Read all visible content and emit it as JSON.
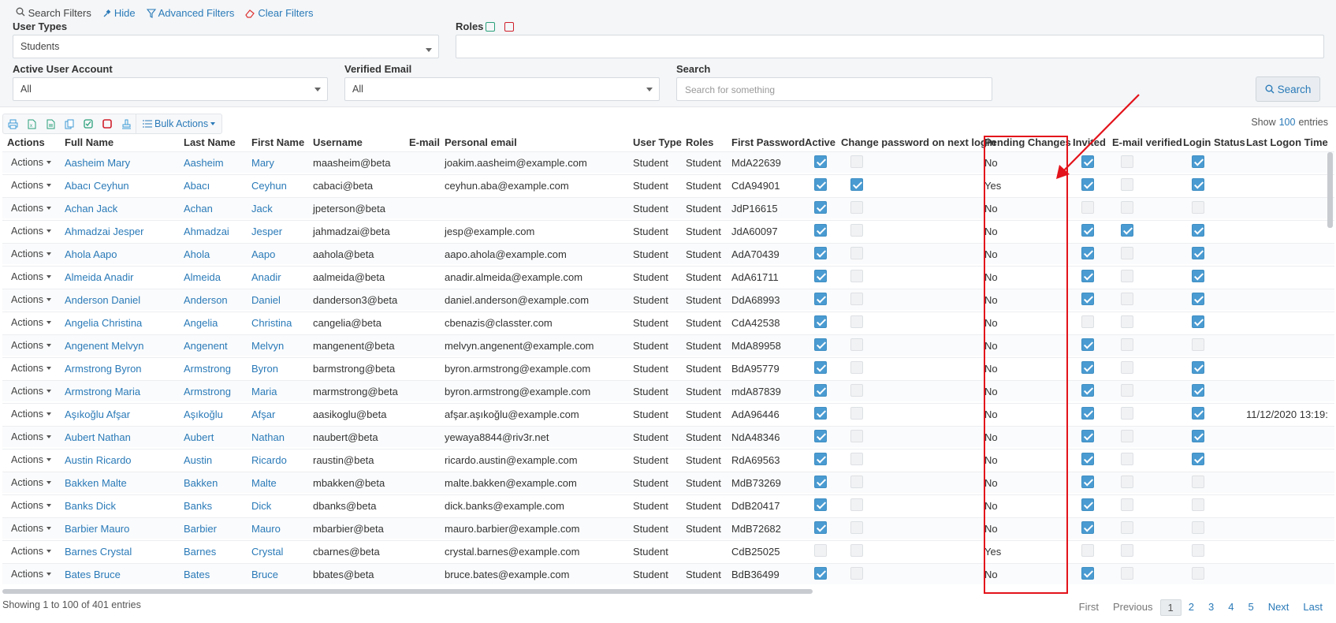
{
  "filters": {
    "search_filters": "Search Filters",
    "hide": "Hide",
    "advanced": "Advanced Filters",
    "clear": "Clear Filters",
    "user_types_label": "User Types",
    "user_types_value": "Students",
    "roles_label": "Roles",
    "active_label": "Active User Account",
    "active_value": "All",
    "verified_label": "Verified Email",
    "verified_value": "All",
    "search_label": "Search",
    "search_placeholder": "Search for something",
    "search_button": "Search"
  },
  "toolbar": {
    "bulk_actions": "Bulk Actions"
  },
  "show": {
    "prefix": "Show",
    "value": "100",
    "suffix": "entries"
  },
  "columns": [
    "Actions",
    "Full Name",
    "Last Name",
    "First Name",
    "Username",
    "E-mail",
    "Personal email",
    "User Type",
    "Roles",
    "First Password",
    "Active",
    "Change password on next login",
    "Pending Changes",
    "Invited",
    "E-mail verified",
    "Login Status",
    "Last Logon Time"
  ],
  "action_label": "Actions",
  "rows": [
    {
      "full": "Aasheim Mary",
      "last": "Aasheim",
      "first": "Mary",
      "user": "maasheim@beta",
      "pemail": "joakim.aasheim@example.com",
      "type": "Student",
      "role": "Student",
      "pwd": "MdA22639",
      "active": true,
      "chg": false,
      "pending": "No",
      "invited": true,
      "verified": false,
      "login": true,
      "logon": ""
    },
    {
      "full": "Abacı Ceyhun",
      "last": "Abacı",
      "first": "Ceyhun",
      "user": "cabaci@beta",
      "pemail": "ceyhun.aba@example.com",
      "type": "Student",
      "role": "Student",
      "pwd": "CdA94901",
      "active": true,
      "chg": true,
      "pending": "Yes",
      "invited": true,
      "verified": false,
      "login": true,
      "logon": ""
    },
    {
      "full": "Achan Jack",
      "last": "Achan",
      "first": "Jack",
      "user": "jpeterson@beta",
      "pemail": "",
      "type": "Student",
      "role": "Student",
      "pwd": "JdP16615",
      "active": true,
      "chg": false,
      "pending": "No",
      "invited": false,
      "verified": false,
      "login": false,
      "logon": ""
    },
    {
      "full": "Ahmadzai Jesper",
      "last": "Ahmadzai",
      "first": "Jesper",
      "user": "jahmadzai@beta",
      "pemail": "jesp@example.com",
      "type": "Student",
      "role": "Student",
      "pwd": "JdA60097",
      "active": true,
      "chg": false,
      "pending": "No",
      "invited": true,
      "verified": true,
      "login": true,
      "logon": ""
    },
    {
      "full": "Ahola Aapo",
      "last": "Ahola",
      "first": "Aapo",
      "user": "aahola@beta",
      "pemail": "aapo.ahola@example.com",
      "type": "Student",
      "role": "Student",
      "pwd": "AdA70439",
      "active": true,
      "chg": false,
      "pending": "No",
      "invited": true,
      "verified": false,
      "login": true,
      "logon": ""
    },
    {
      "full": "Almeida Anadir",
      "last": "Almeida",
      "first": "Anadir",
      "user": "aalmeida@beta",
      "pemail": "anadir.almeida@example.com",
      "type": "Student",
      "role": "Student",
      "pwd": "AdA61711",
      "active": true,
      "chg": false,
      "pending": "No",
      "invited": true,
      "verified": false,
      "login": true,
      "logon": ""
    },
    {
      "full": "Anderson Daniel",
      "last": "Anderson",
      "first": "Daniel",
      "user": "danderson3@beta",
      "pemail": "daniel.anderson@example.com",
      "type": "Student",
      "role": "Student",
      "pwd": "DdA68993",
      "active": true,
      "chg": false,
      "pending": "No",
      "invited": true,
      "verified": false,
      "login": true,
      "logon": ""
    },
    {
      "full": "Angelia Christina",
      "last": "Angelia",
      "first": "Christina",
      "user": "cangelia@beta",
      "pemail": "cbenazis@classter.com",
      "type": "Student",
      "role": "Student",
      "pwd": "CdA42538",
      "active": true,
      "chg": false,
      "pending": "No",
      "invited": false,
      "verified": false,
      "login": true,
      "logon": ""
    },
    {
      "full": "Angenent Melvyn",
      "last": "Angenent",
      "first": "Melvyn",
      "user": "mangenent@beta",
      "pemail": "melvyn.angenent@example.com",
      "type": "Student",
      "role": "Student",
      "pwd": "MdA89958",
      "active": true,
      "chg": false,
      "pending": "No",
      "invited": true,
      "verified": false,
      "login": false,
      "logon": ""
    },
    {
      "full": "Armstrong Byron",
      "last": "Armstrong",
      "first": "Byron",
      "user": "barmstrong@beta",
      "pemail": "byron.armstrong@example.com",
      "type": "Student",
      "role": "Student",
      "pwd": "BdA95779",
      "active": true,
      "chg": false,
      "pending": "No",
      "invited": true,
      "verified": false,
      "login": true,
      "logon": ""
    },
    {
      "full": "Armstrong Maria",
      "last": "Armstrong",
      "first": "Maria",
      "user": "marmstrong@beta",
      "pemail": "byron.armstrong@example.com",
      "type": "Student",
      "role": "Student",
      "pwd": "mdA87839",
      "active": true,
      "chg": false,
      "pending": "No",
      "invited": true,
      "verified": false,
      "login": true,
      "logon": ""
    },
    {
      "full": "Aşıkoğlu Afşar",
      "last": "Aşıkoğlu",
      "first": "Afşar",
      "user": "aasikoglu@beta",
      "pemail": "afşar.aşıkoğlu@example.com",
      "type": "Student",
      "role": "Student",
      "pwd": "AdA96446",
      "active": true,
      "chg": false,
      "pending": "No",
      "invited": true,
      "verified": false,
      "login": true,
      "logon": "11/12/2020 13:19:"
    },
    {
      "full": "Aubert Nathan",
      "last": "Aubert",
      "first": "Nathan",
      "user": "naubert@beta",
      "pemail": "yewaya8844@riv3r.net",
      "type": "Student",
      "role": "Student",
      "pwd": "NdA48346",
      "active": true,
      "chg": false,
      "pending": "No",
      "invited": true,
      "verified": false,
      "login": true,
      "logon": ""
    },
    {
      "full": "Austin Ricardo",
      "last": "Austin",
      "first": "Ricardo",
      "user": "raustin@beta",
      "pemail": "ricardo.austin@example.com",
      "type": "Student",
      "role": "Student",
      "pwd": "RdA69563",
      "active": true,
      "chg": false,
      "pending": "No",
      "invited": true,
      "verified": false,
      "login": true,
      "logon": ""
    },
    {
      "full": "Bakken Malte",
      "last": "Bakken",
      "first": "Malte",
      "user": "mbakken@beta",
      "pemail": "malte.bakken@example.com",
      "type": "Student",
      "role": "Student",
      "pwd": "MdB73269",
      "active": true,
      "chg": false,
      "pending": "No",
      "invited": true,
      "verified": false,
      "login": false,
      "logon": ""
    },
    {
      "full": "Banks Dick",
      "last": "Banks",
      "first": "Dick",
      "user": "dbanks@beta",
      "pemail": "dick.banks@example.com",
      "type": "Student",
      "role": "Student",
      "pwd": "DdB20417",
      "active": true,
      "chg": false,
      "pending": "No",
      "invited": true,
      "verified": false,
      "login": false,
      "logon": ""
    },
    {
      "full": "Barbier Mauro",
      "last": "Barbier",
      "first": "Mauro",
      "user": "mbarbier@beta",
      "pemail": "mauro.barbier@example.com",
      "type": "Student",
      "role": "Student",
      "pwd": "MdB72682",
      "active": true,
      "chg": false,
      "pending": "No",
      "invited": true,
      "verified": false,
      "login": false,
      "logon": ""
    },
    {
      "full": "Barnes Crystal",
      "last": "Barnes",
      "first": "Crystal",
      "user": "cbarnes@beta",
      "pemail": "crystal.barnes@example.com",
      "type": "Student",
      "role": "",
      "pwd": "CdB25025",
      "active": false,
      "chg": false,
      "pending": "Yes",
      "invited": false,
      "verified": false,
      "login": false,
      "logon": ""
    },
    {
      "full": "Bates Bruce",
      "last": "Bates",
      "first": "Bruce",
      "user": "bbates@beta",
      "pemail": "bruce.bates@example.com",
      "type": "Student",
      "role": "Student",
      "pwd": "BdB36499",
      "active": true,
      "chg": false,
      "pending": "No",
      "invited": true,
      "verified": false,
      "login": false,
      "logon": ""
    }
  ],
  "footer": {
    "info": "Showing 1 to 100 of 401 entries",
    "first": "First",
    "previous": "Previous",
    "pages": [
      "1",
      "2",
      "3",
      "4",
      "5"
    ],
    "next": "Next",
    "last": "Last"
  },
  "colors": {
    "accent": "#2a7ab8",
    "checkbox": "#4a9bd1",
    "highlight": "#e3131b"
  }
}
